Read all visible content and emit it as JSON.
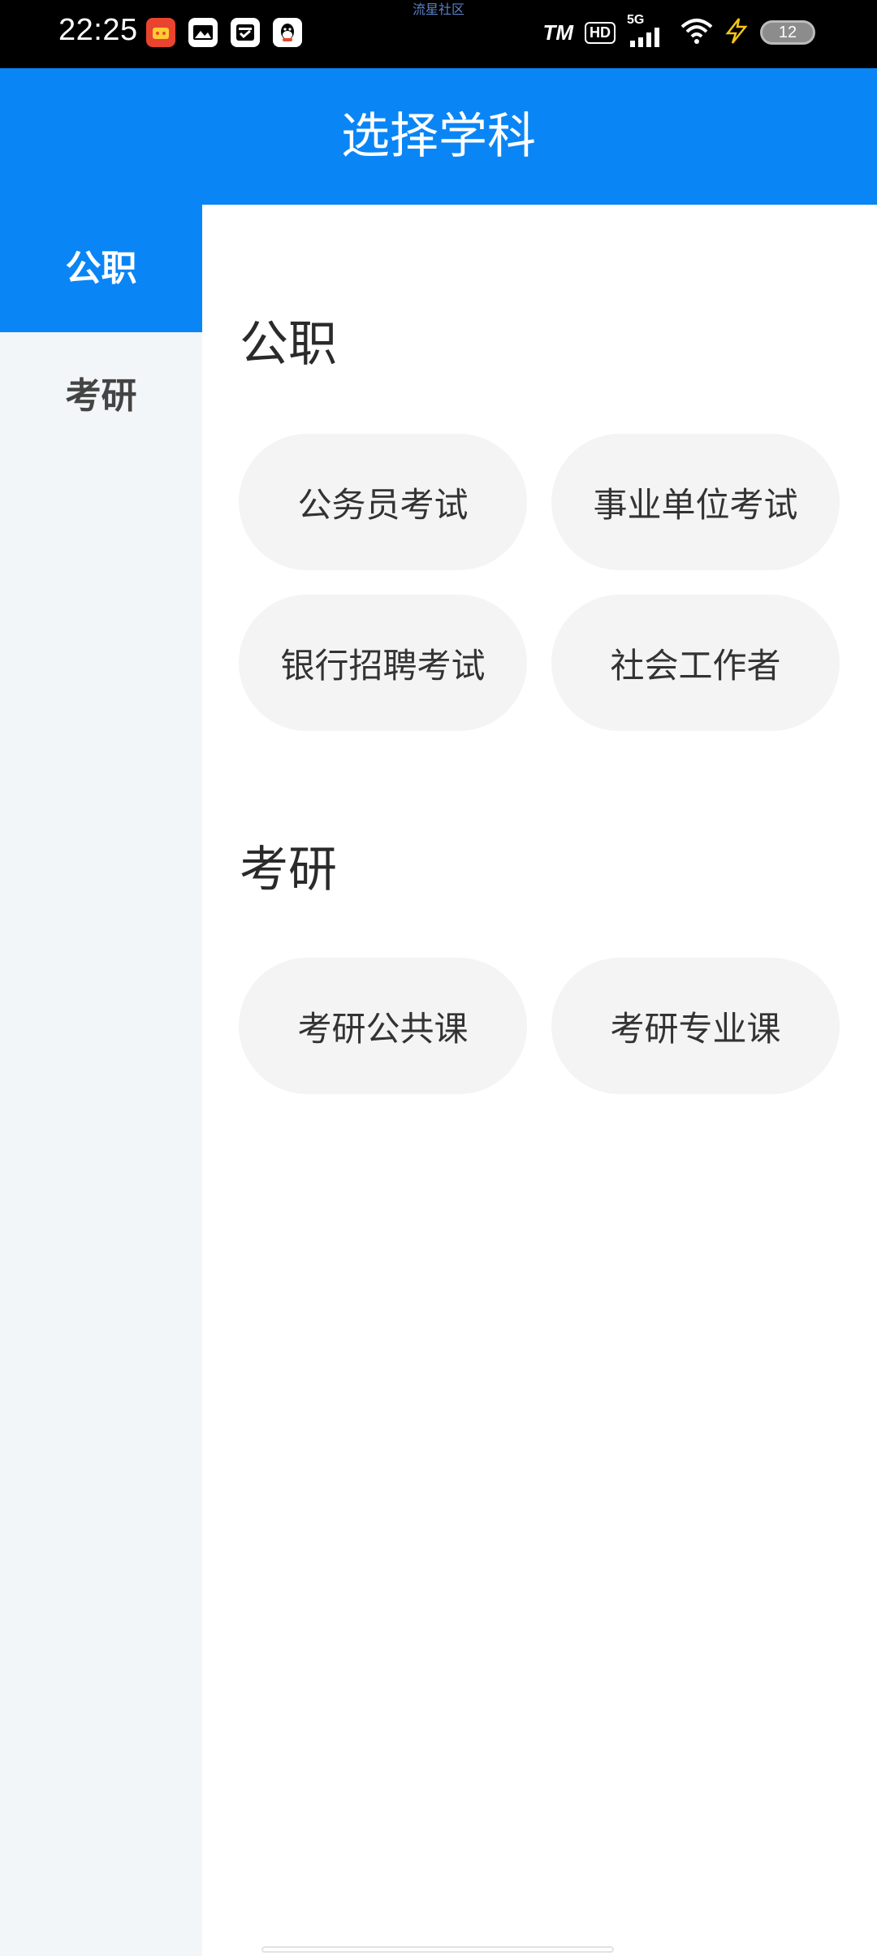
{
  "status_bar": {
    "time": "22:25",
    "carrier_text": "流星社区",
    "network_label": "5G",
    "hd_label": "HD",
    "signal_label": "TM",
    "battery_level": "12",
    "notification_icons": [
      "app-icon-red",
      "gallery-icon",
      "inbox-icon",
      "qq-icon"
    ]
  },
  "header": {
    "title": "选择学科"
  },
  "sidebar": {
    "items": [
      {
        "label": "公职",
        "active": true
      },
      {
        "label": "考研",
        "active": false
      }
    ]
  },
  "sections": [
    {
      "title": "公职",
      "options": [
        "公务员考试",
        "事业单位考试",
        "银行招聘考试",
        "社会工作者"
      ]
    },
    {
      "title": "考研",
      "options": [
        "考研公共课",
        "考研专业课"
      ]
    }
  ],
  "colors": {
    "accent": "#0a85f5",
    "sidebar_bg": "#f3f6f9",
    "chip_bg": "#f4f4f4"
  }
}
